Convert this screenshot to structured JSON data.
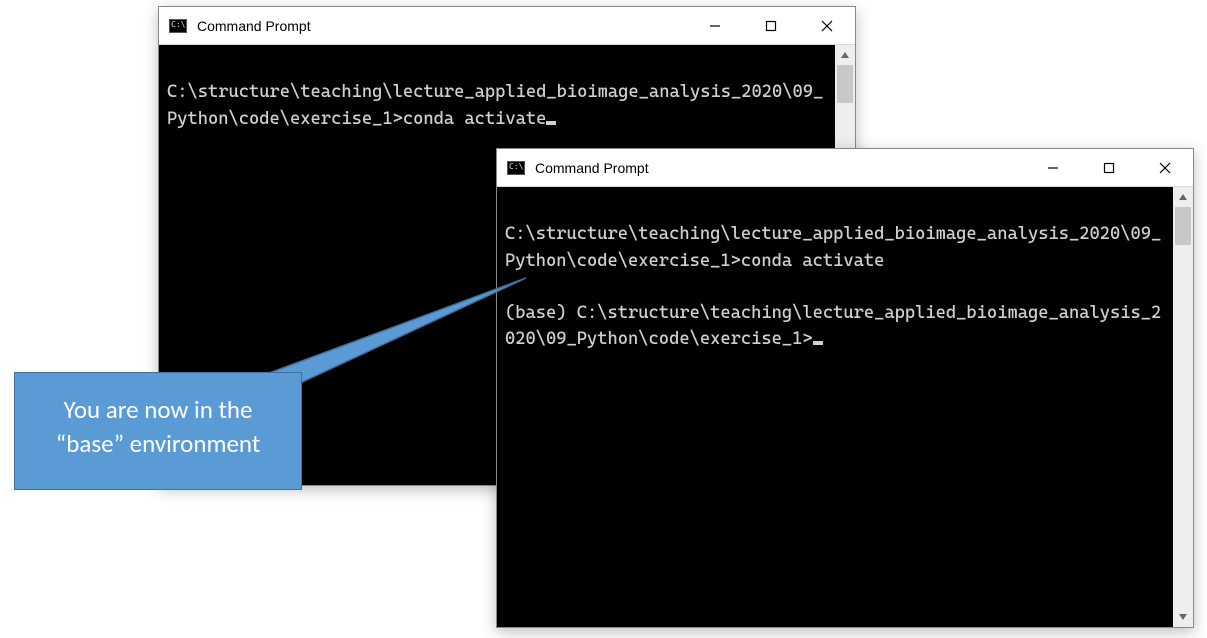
{
  "window1": {
    "title": "Command Prompt",
    "line1": "C:\\structure\\teaching\\lecture_applied_bioimage_analysis_2020\\09_Python\\code\\exercise_1>conda activate"
  },
  "window2": {
    "title": "Command Prompt",
    "line1": "C:\\structure\\teaching\\lecture_applied_bioimage_analysis_2020\\09_Python\\code\\exercise_1>conda activate",
    "line2": "(base) C:\\structure\\teaching\\lecture_applied_bioimage_analysis_2020\\09_Python\\code\\exercise_1>"
  },
  "callout": {
    "text": "You are now in the “base” environment"
  }
}
